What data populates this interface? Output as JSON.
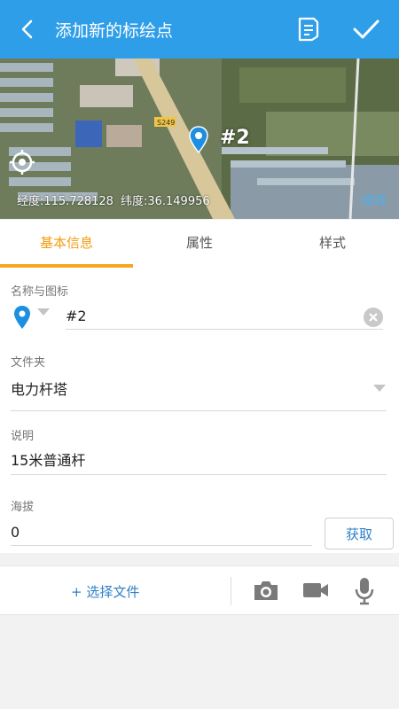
{
  "header": {
    "title": "添加新的标绘点",
    "back_icon": "chevron-left-icon",
    "notes_icon": "notes-icon",
    "confirm_icon": "checkmark-icon"
  },
  "map": {
    "marker_label": "#2",
    "road_label": "S249",
    "longitude_text": "经度:115.728128",
    "latitude_text": "纬度:36.149956",
    "modify_label": "修改"
  },
  "tabs": [
    {
      "label": "基本信息",
      "active": true
    },
    {
      "label": "属性",
      "active": false
    },
    {
      "label": "样式",
      "active": false
    }
  ],
  "form": {
    "name_label": "名称与图标",
    "name_value": "#2",
    "folder_label": "文件夹",
    "folder_value": "电力杆塔",
    "desc_label": "说明",
    "desc_value": "15米普通杆",
    "altitude_label": "海拔",
    "altitude_value": "0",
    "fetch_label": "获取"
  },
  "attachments": {
    "choose_file_label": "+  选择文件"
  },
  "colors": {
    "header_bg": "#2f9ee9",
    "tab_active": "#f39c12",
    "link": "#2f80c8"
  }
}
